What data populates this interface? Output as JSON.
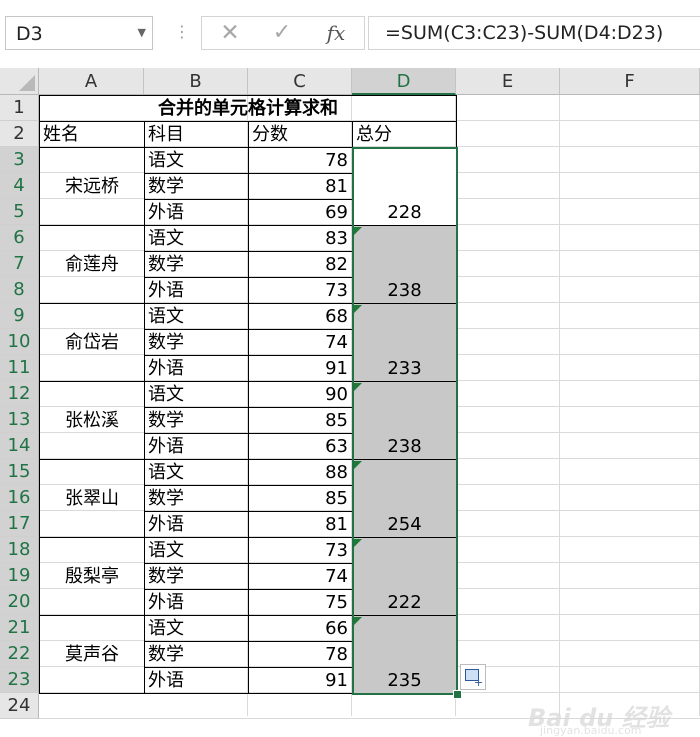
{
  "formula_bar": {
    "name_box": "D3",
    "separator": "⋮",
    "cancel_label": "✕",
    "enter_label": "✓",
    "fx_label": "fx",
    "formula": "=SUM(C3:C23)-SUM(D4:D23)"
  },
  "columns": [
    "A",
    "B",
    "C",
    "D",
    "E",
    "F"
  ],
  "rows": [
    "1",
    "2",
    "3",
    "4",
    "5",
    "6",
    "7",
    "8",
    "9",
    "10",
    "11",
    "12",
    "13",
    "14",
    "15",
    "16",
    "17",
    "18",
    "19",
    "20",
    "21",
    "22",
    "23",
    "24"
  ],
  "table": {
    "title": "合并的单元格计算求和",
    "headers": [
      "姓名",
      "科目",
      "分数",
      "总分"
    ],
    "students": [
      {
        "name": "宋远桥",
        "subjects": [
          "语文",
          "数学",
          "外语"
        ],
        "scores": [
          "78",
          "81",
          "69"
        ],
        "total": "228"
      },
      {
        "name": "俞莲舟",
        "subjects": [
          "语文",
          "数学",
          "外语"
        ],
        "scores": [
          "83",
          "82",
          "73"
        ],
        "total": "238"
      },
      {
        "name": "俞岱岩",
        "subjects": [
          "语文",
          "数学",
          "外语"
        ],
        "scores": [
          "68",
          "74",
          "91"
        ],
        "total": "233"
      },
      {
        "name": "张松溪",
        "subjects": [
          "语文",
          "数学",
          "外语"
        ],
        "scores": [
          "90",
          "85",
          "63"
        ],
        "total": "238"
      },
      {
        "name": "张翠山",
        "subjects": [
          "语文",
          "数学",
          "外语"
        ],
        "scores": [
          "88",
          "85",
          "81"
        ],
        "total": "254"
      },
      {
        "name": "殷梨亭",
        "subjects": [
          "语文",
          "数学",
          "外语"
        ],
        "scores": [
          "73",
          "74",
          "75"
        ],
        "total": "222"
      },
      {
        "name": "莫声谷",
        "subjects": [
          "语文",
          "数学",
          "外语"
        ],
        "scores": [
          "66",
          "78",
          "91"
        ],
        "total": "235"
      }
    ]
  },
  "watermark": {
    "text": "Bai du 经验",
    "sub": "jingyan.baidu.com"
  }
}
